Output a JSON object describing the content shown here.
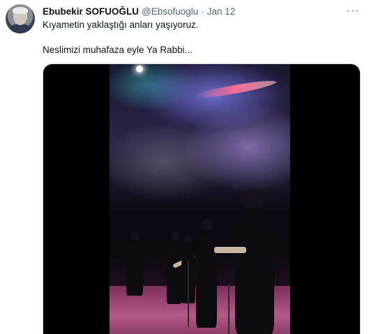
{
  "tweet": {
    "author_name": "Ebubekir SOFUOĞLU",
    "handle": "@Ebsofuoglu",
    "separator": "·",
    "date": "Jan 12",
    "text": "Kıyametin yaklaştığı anları yaşıyoruz.\n\nNeslimizi muhafaza eyle Ya Rabbi...",
    "more_icon": "···"
  },
  "colors": {
    "text": "#0f1419",
    "secondary": "#536471",
    "border": "#cfd9de"
  },
  "icons": {
    "more": "more-horizontal-icon"
  }
}
